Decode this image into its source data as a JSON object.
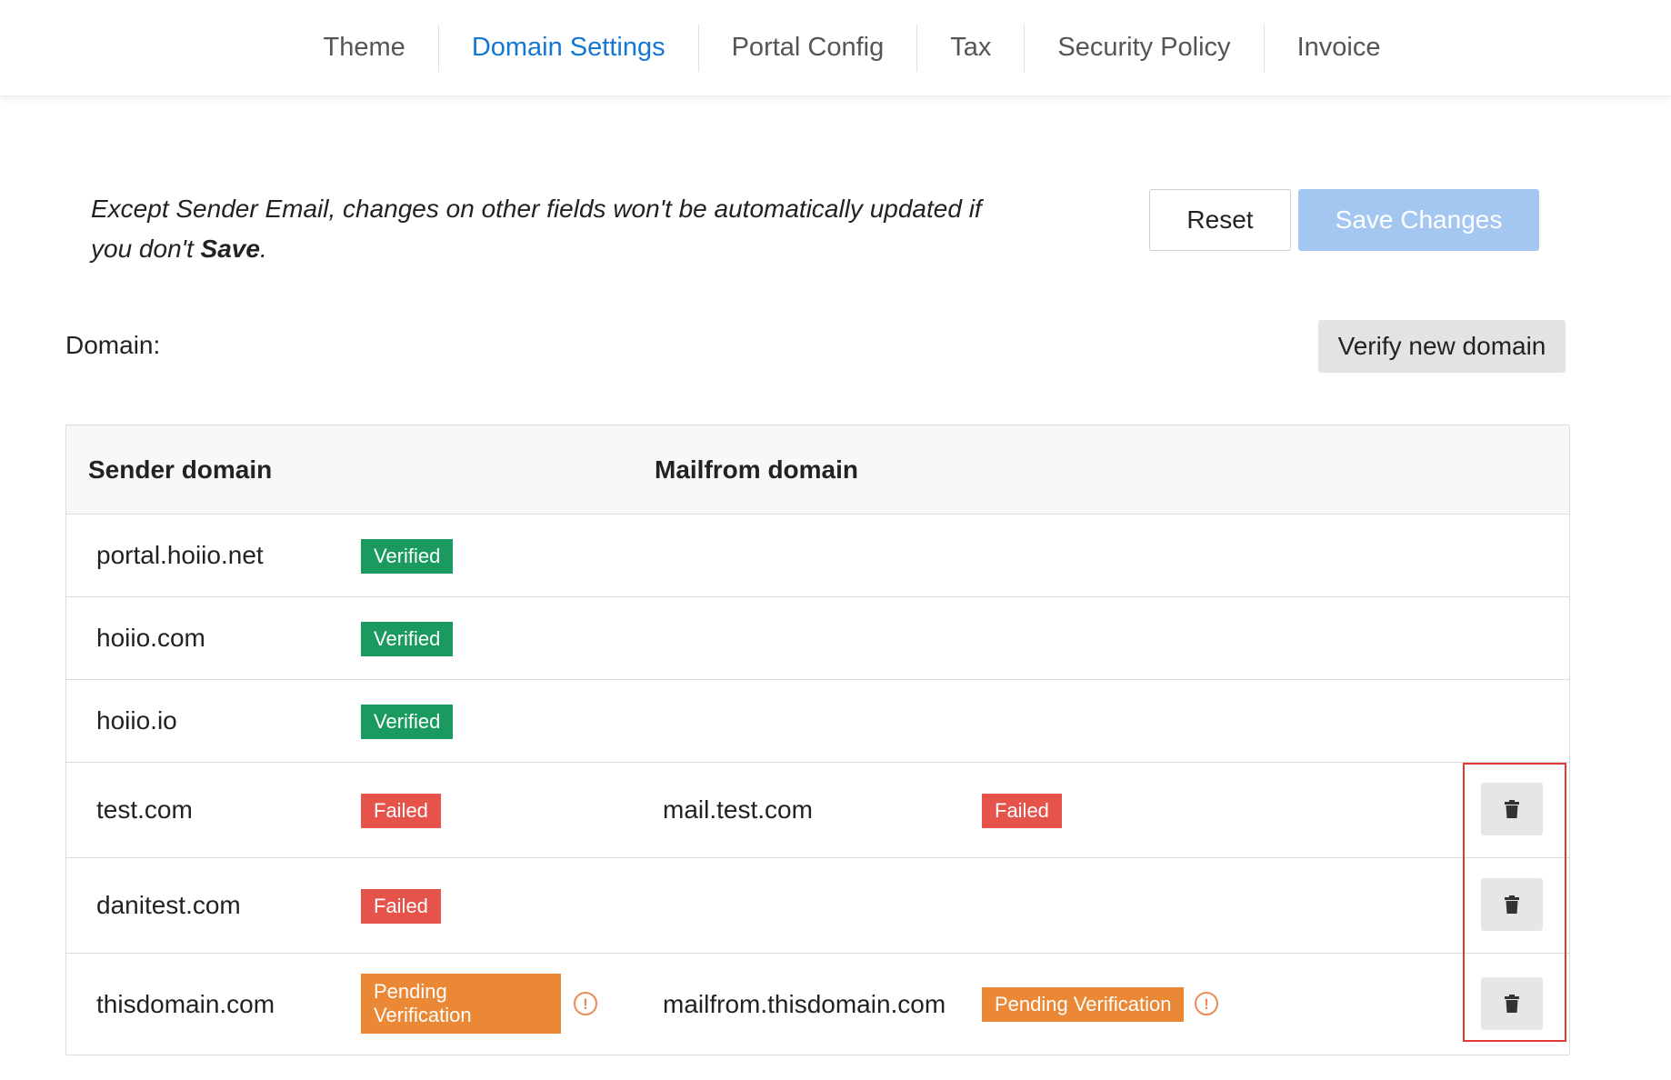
{
  "tabs": [
    {
      "label": "Theme",
      "active": false
    },
    {
      "label": "Domain Settings",
      "active": true
    },
    {
      "label": "Portal Config",
      "active": false
    },
    {
      "label": "Tax",
      "active": false
    },
    {
      "label": "Security Policy",
      "active": false
    },
    {
      "label": "Invoice",
      "active": false
    }
  ],
  "notice": {
    "text": "Except Sender Email, changes on other fields won't be automatically updated if you don't ",
    "bold": "Save",
    "end": "."
  },
  "actions": {
    "reset_label": "Reset",
    "save_label": "Save Changes",
    "verify_label": "Verify new domain"
  },
  "domain_label": "Domain:",
  "table": {
    "headers": {
      "sender": "Sender domain",
      "mailfrom": "Mailfrom domain"
    },
    "rows": [
      {
        "sender": "portal.hoiio.net",
        "sender_status": "Verified",
        "mailfrom": "",
        "mailfrom_status": "",
        "deletable": false
      },
      {
        "sender": "hoiio.com",
        "sender_status": "Verified",
        "mailfrom": "",
        "mailfrom_status": "",
        "deletable": false
      },
      {
        "sender": "hoiio.io",
        "sender_status": "Verified",
        "mailfrom": "",
        "mailfrom_status": "",
        "deletable": false
      },
      {
        "sender": "test.com",
        "sender_status": "Failed",
        "mailfrom": "mail.test.com",
        "mailfrom_status": "Failed",
        "deletable": true
      },
      {
        "sender": "danitest.com",
        "sender_status": "Failed",
        "mailfrom": "",
        "mailfrom_status": "",
        "deletable": true
      },
      {
        "sender": "thisdomain.com",
        "sender_status": "Pending Verification",
        "mailfrom": "mailfrom.thisdomain.com",
        "mailfrom_status": "Pending Verification",
        "deletable": true
      }
    ]
  },
  "colors": {
    "accent": "#1577d4",
    "verified": "#1a9a5f",
    "failed": "#e5534b",
    "pending": "#ea8836",
    "highlight": "#e43a3a"
  },
  "icons": {
    "trash": "trash-icon",
    "warning": "exclamation-circle-icon"
  }
}
